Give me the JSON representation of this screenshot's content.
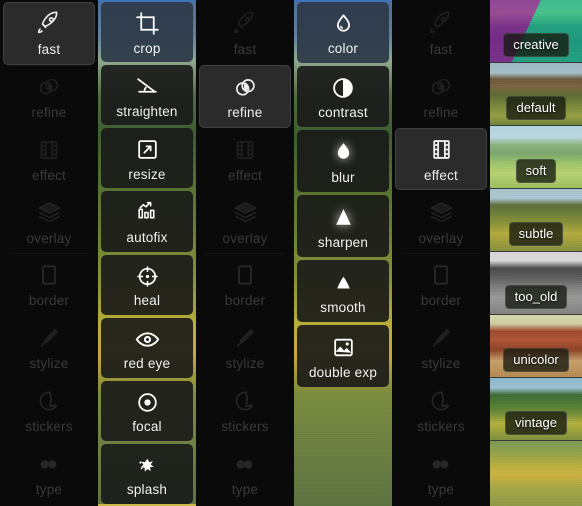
{
  "app": {
    "title": "Photo Editor Tool Menus",
    "accent_selected_bg": "#2b2b2b",
    "accent_highlight_bg": "#2d3848",
    "text_active": "#ededed",
    "text_dim": "#3a3a3a"
  },
  "columns": [
    {
      "id": "nav-1",
      "type": "nav",
      "selected": "fast",
      "items": [
        {
          "label": "fast",
          "icon": "rocket-icon",
          "state": "selected"
        },
        {
          "label": "refine",
          "icon": "lens-icon",
          "state": "dim"
        },
        {
          "label": "effect",
          "icon": "filmstrip-icon",
          "state": "dim"
        },
        {
          "label": "overlay",
          "icon": "layers-icon",
          "state": "dim"
        },
        {
          "label": "border",
          "icon": "frame-icon",
          "state": "dim"
        },
        {
          "label": "stylize",
          "icon": "brush-icon",
          "state": "dim"
        },
        {
          "label": "stickers",
          "icon": "sticker-icon",
          "state": "dim"
        },
        {
          "label": "type",
          "icon": "quote-icon",
          "state": "dim"
        }
      ]
    },
    {
      "id": "sub-fast",
      "type": "sub",
      "items": [
        {
          "label": "crop",
          "icon": "crop-icon",
          "state": "highlighted"
        },
        {
          "label": "straighten",
          "icon": "straighten-icon",
          "state": "normal"
        },
        {
          "label": "resize",
          "icon": "resize-icon",
          "state": "normal"
        },
        {
          "label": "autofix",
          "icon": "autofix-icon",
          "state": "normal"
        },
        {
          "label": "heal",
          "icon": "heal-icon",
          "state": "normal"
        },
        {
          "label": "red eye",
          "icon": "eye-icon",
          "state": "normal"
        },
        {
          "label": "focal",
          "icon": "focal-icon",
          "state": "normal"
        },
        {
          "label": "splash",
          "icon": "splash-icon",
          "state": "normal"
        }
      ]
    },
    {
      "id": "nav-2",
      "type": "nav",
      "selected": "refine",
      "items": [
        {
          "label": "fast",
          "icon": "rocket-icon",
          "state": "dim"
        },
        {
          "label": "refine",
          "icon": "lens-icon",
          "state": "selected"
        },
        {
          "label": "effect",
          "icon": "filmstrip-icon",
          "state": "dim"
        },
        {
          "label": "overlay",
          "icon": "layers-icon",
          "state": "dim"
        },
        {
          "label": "border",
          "icon": "frame-icon",
          "state": "dim"
        },
        {
          "label": "stylize",
          "icon": "brush-icon",
          "state": "dim"
        },
        {
          "label": "stickers",
          "icon": "sticker-icon",
          "state": "dim"
        },
        {
          "label": "type",
          "icon": "quote-icon",
          "state": "dim"
        }
      ]
    },
    {
      "id": "sub-refine",
      "type": "sub",
      "items": [
        {
          "label": "color",
          "icon": "droplet-outline-icon",
          "state": "highlighted"
        },
        {
          "label": "contrast",
          "icon": "contrast-icon",
          "state": "normal"
        },
        {
          "label": "blur",
          "icon": "droplet-glow-icon",
          "state": "normal"
        },
        {
          "label": "sharpen",
          "icon": "triangle-glow-icon",
          "state": "normal"
        },
        {
          "label": "smooth",
          "icon": "triangle-soft-icon",
          "state": "normal"
        },
        {
          "label": "double exp",
          "icon": "image-icon",
          "state": "normal"
        }
      ]
    },
    {
      "id": "nav-3",
      "type": "nav",
      "selected": "effect",
      "items": [
        {
          "label": "fast",
          "icon": "rocket-icon",
          "state": "dim"
        },
        {
          "label": "refine",
          "icon": "lens-icon",
          "state": "dim"
        },
        {
          "label": "effect",
          "icon": "filmstrip-icon",
          "state": "selected"
        },
        {
          "label": "overlay",
          "icon": "layers-icon",
          "state": "dim"
        },
        {
          "label": "border",
          "icon": "frame-icon",
          "state": "dim"
        },
        {
          "label": "stylize",
          "icon": "brush-icon",
          "state": "dim"
        },
        {
          "label": "stickers",
          "icon": "sticker-icon",
          "state": "dim"
        },
        {
          "label": "type",
          "icon": "quote-icon",
          "state": "dim"
        }
      ]
    },
    {
      "id": "presets",
      "type": "preset",
      "items": [
        {
          "label": "creative",
          "thumb": "t-creative"
        },
        {
          "label": "default",
          "thumb": "t-default"
        },
        {
          "label": "soft",
          "thumb": "t-soft"
        },
        {
          "label": "subtle",
          "thumb": "t-subtle"
        },
        {
          "label": "too_old",
          "thumb": "t-tooold"
        },
        {
          "label": "unicolor",
          "thumb": "t-unicolor"
        },
        {
          "label": "vintage",
          "thumb": "t-vintage"
        }
      ]
    }
  ]
}
